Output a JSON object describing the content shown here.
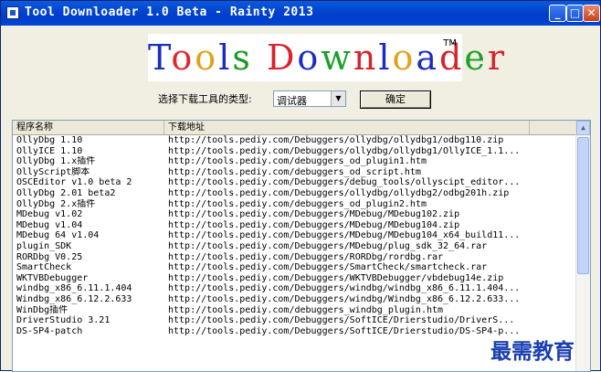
{
  "window": {
    "title": "Tool Downloader 1.0 Beta - Rainty 2013",
    "minimize": "_",
    "maximize": "□",
    "close": "✕"
  },
  "logo": {
    "letters": [
      {
        "ch": "T",
        "color": "#1a2fb8"
      },
      {
        "ch": "o",
        "color": "#e0282a"
      },
      {
        "ch": "o",
        "color": "#e0a218"
      },
      {
        "ch": "l",
        "color": "#1d2cc0"
      },
      {
        "ch": "s",
        "color": "#199b27"
      },
      {
        "ch": " ",
        "color": "#000000"
      },
      {
        "ch": "D",
        "color": "#d9222a"
      },
      {
        "ch": "o",
        "color": "#1d2cc0"
      },
      {
        "ch": "w",
        "color": "#1aa12a"
      },
      {
        "ch": "n",
        "color": "#d9222a"
      },
      {
        "ch": "l",
        "color": "#1d2cc0"
      },
      {
        "ch": "o",
        "color": "#e0a218"
      },
      {
        "ch": "a",
        "color": "#1d2cc0"
      },
      {
        "ch": "d",
        "color": "#d9222a"
      },
      {
        "ch": "e",
        "color": "#1aa12a"
      },
      {
        "ch": "r",
        "color": "#d9222a"
      }
    ],
    "trademark": "TM"
  },
  "filter": {
    "label": "选择下载工具的类型:",
    "selected": "调试器",
    "ok_label": "确定"
  },
  "list": {
    "columns": [
      "程序名称",
      "下载地址"
    ],
    "rows": [
      [
        "OllyDbg 1.10",
        "http://tools.pediy.com/Debuggers/ollydbg/ollydbg1/odbg110.zip"
      ],
      [
        "OllyICE 1.10",
        "http://tools.pediy.com/Debuggers/ollydbg/ollydbg1/OllyICE_1.1..."
      ],
      [
        "OllyDbg 1.x插件",
        "http://tools.pediy.com/debuggers_od_plugin1.htm"
      ],
      [
        "OllyScript脚本",
        "http://tools.pediy.com/debuggers_od_script.htm"
      ],
      [
        "OSCEditor v1.0 beta 2",
        "http://tools.pediy.com/Debuggers/debug_tools/ollyscipt_editor..."
      ],
      [
        "OllyDbg 2.01 beta2",
        "http://tools.pediy.com/Debuggers/ollydbg/ollydbg2/odbg201h.zip"
      ],
      [
        "OllyDbg 2.x插件",
        "http://tools.pediy.com/debuggers_od_plugin2.htm"
      ],
      [
        "MDebug v1.02",
        "http://tools.pediy.com/Debuggers/MDebug/MDebug102.zip"
      ],
      [
        "MDebug v1.04",
        "http://tools.pediy.com/Debuggers/MDebug/MDebug104.zip"
      ],
      [
        "MDebug 64 v1.04",
        "http://tools.pediy.com/Debuggers/MDebug/MDebug104_x64_build11..."
      ],
      [
        "plugin_SDK",
        "http://tools.pediy.com/Debuggers/MDebug/plug_sdk_32_64.rar"
      ],
      [
        "RORDbg V0.25",
        "http://tools.pediy.com/Debuggers/RORDbg/rordbg.rar"
      ],
      [
        "SmartCheck",
        "http://tools.pediy.com/Debuggers/SmartCheck/smartcheck.rar"
      ],
      [
        "WKTVBDebugger",
        "http://tools.pediy.com/Debuggers/WKTVBDebugger/vbdebug14e.zip"
      ],
      [
        "windbg_x86_6.11.1.404",
        "http://tools.pediy.com/Debuggers/windbg/windbg_x86_6.11.1.404..."
      ],
      [
        "Windbg_x86_6.12.2.633",
        "http://tools.pediy.com/Debuggers/windbg/Windbg_x86_6.12.2.633..."
      ],
      [
        "WinDbg插件",
        "http://tools.pediy.com/debuggers_windbg_plugin.htm"
      ],
      [
        "DriverStudio 3.21",
        "http://tools.pediy.com/Debuggers/SoftICE/Drierstudio/DriverS..."
      ],
      [
        "DS-SP4-patch",
        "http://tools.pediy.com/Debuggers/SoftICE/Drierstudio/DS-SP4-p..."
      ]
    ]
  },
  "watermark": "最需教育"
}
